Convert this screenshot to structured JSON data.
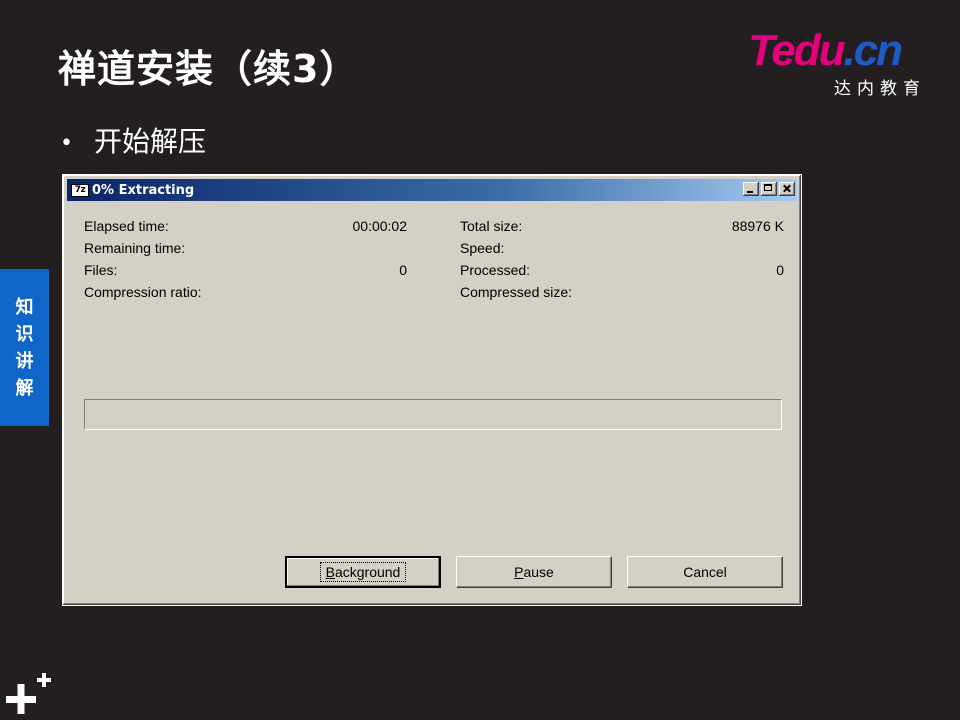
{
  "slide": {
    "title": "禅道安装（续3）",
    "bullet": "开始解压",
    "side_tab": [
      "知",
      "识",
      "讲",
      "解"
    ]
  },
  "logo": {
    "main_pink": "Tedu",
    "main_blue": ".cn",
    "sub": "达内教育"
  },
  "window": {
    "icon_text": "7z",
    "title": "0% Extracting",
    "controls": [
      "minimize",
      "maximize",
      "close"
    ],
    "stats": {
      "elapsed_label": "Elapsed time:",
      "elapsed_value": "00:00:02",
      "remaining_label": "Remaining time:",
      "files_label": "Files:",
      "files_value": "0",
      "ratio_label": "Compression ratio:",
      "total_label": "Total size:",
      "total_value": "88976 K",
      "speed_label": "Speed:",
      "processed_label": "Processed:",
      "processed_value": "0",
      "compressed_label": "Compressed size:"
    },
    "progress_fraction": 0,
    "buttons": {
      "background": "Background",
      "pause": "Pause",
      "cancel": "Cancel"
    }
  },
  "colors": {
    "slide_bg": "#231f20",
    "accent_blue": "#1066c8",
    "logo_pink": "#e6007e",
    "titlebar_start": "#0a246a",
    "window_face": "#d4d0c8"
  }
}
